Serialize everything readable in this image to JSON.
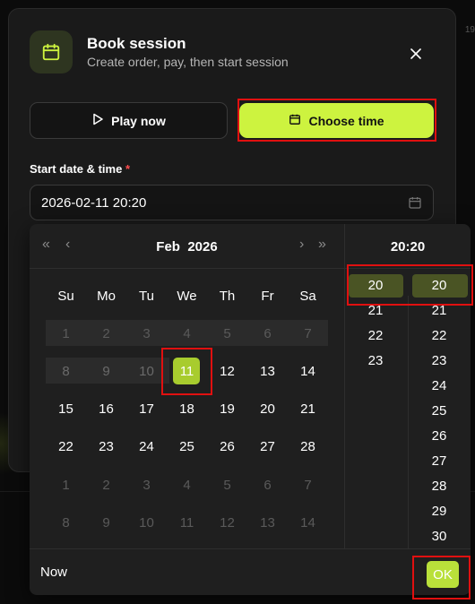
{
  "background": {
    "corner_number": "19"
  },
  "modal": {
    "title": "Book session",
    "subtitle": "Create order, pay, then start session",
    "play_now_label": "Play now",
    "choose_time_label": "Choose time",
    "field_label": "Start date & time",
    "required_mark": "*",
    "date_value": "2026-02-11 20:20"
  },
  "picker": {
    "nav": {
      "prev_year": "«",
      "prev_month": "‹",
      "next_month": "›",
      "next_year": "»"
    },
    "month": "Feb",
    "year": "2026",
    "weekdays": [
      "Su",
      "Mo",
      "Tu",
      "We",
      "Th",
      "Fr",
      "Sa"
    ],
    "weeks": [
      [
        "1",
        "2",
        "3",
        "4",
        "5",
        "6",
        "7"
      ],
      [
        "8",
        "9",
        "10",
        "11",
        "12",
        "13",
        "14"
      ],
      [
        "15",
        "16",
        "17",
        "18",
        "19",
        "20",
        "21"
      ],
      [
        "22",
        "23",
        "24",
        "25",
        "26",
        "27",
        "28"
      ],
      [
        "1",
        "2",
        "3",
        "4",
        "5",
        "6",
        "7"
      ],
      [
        "8",
        "9",
        "10",
        "11",
        "12",
        "13",
        "14"
      ]
    ],
    "selected_day": "11",
    "time_header": "20:20",
    "hours": [
      "20",
      "21",
      "22",
      "23"
    ],
    "minutes": [
      "20",
      "21",
      "22",
      "23",
      "24",
      "25",
      "26",
      "27",
      "28",
      "29",
      "30"
    ],
    "now_label": "Now",
    "ok_label": "OK"
  },
  "colors": {
    "accent": "#cdf33f",
    "selected_day": "#a8cc2e",
    "selected_time": "#4a5424",
    "highlight": "#e01010"
  },
  "icons": {
    "header": "calendar-icon",
    "play": "play-icon",
    "choose": "calendar-icon",
    "input": "calendar-icon",
    "close": "close-icon"
  }
}
